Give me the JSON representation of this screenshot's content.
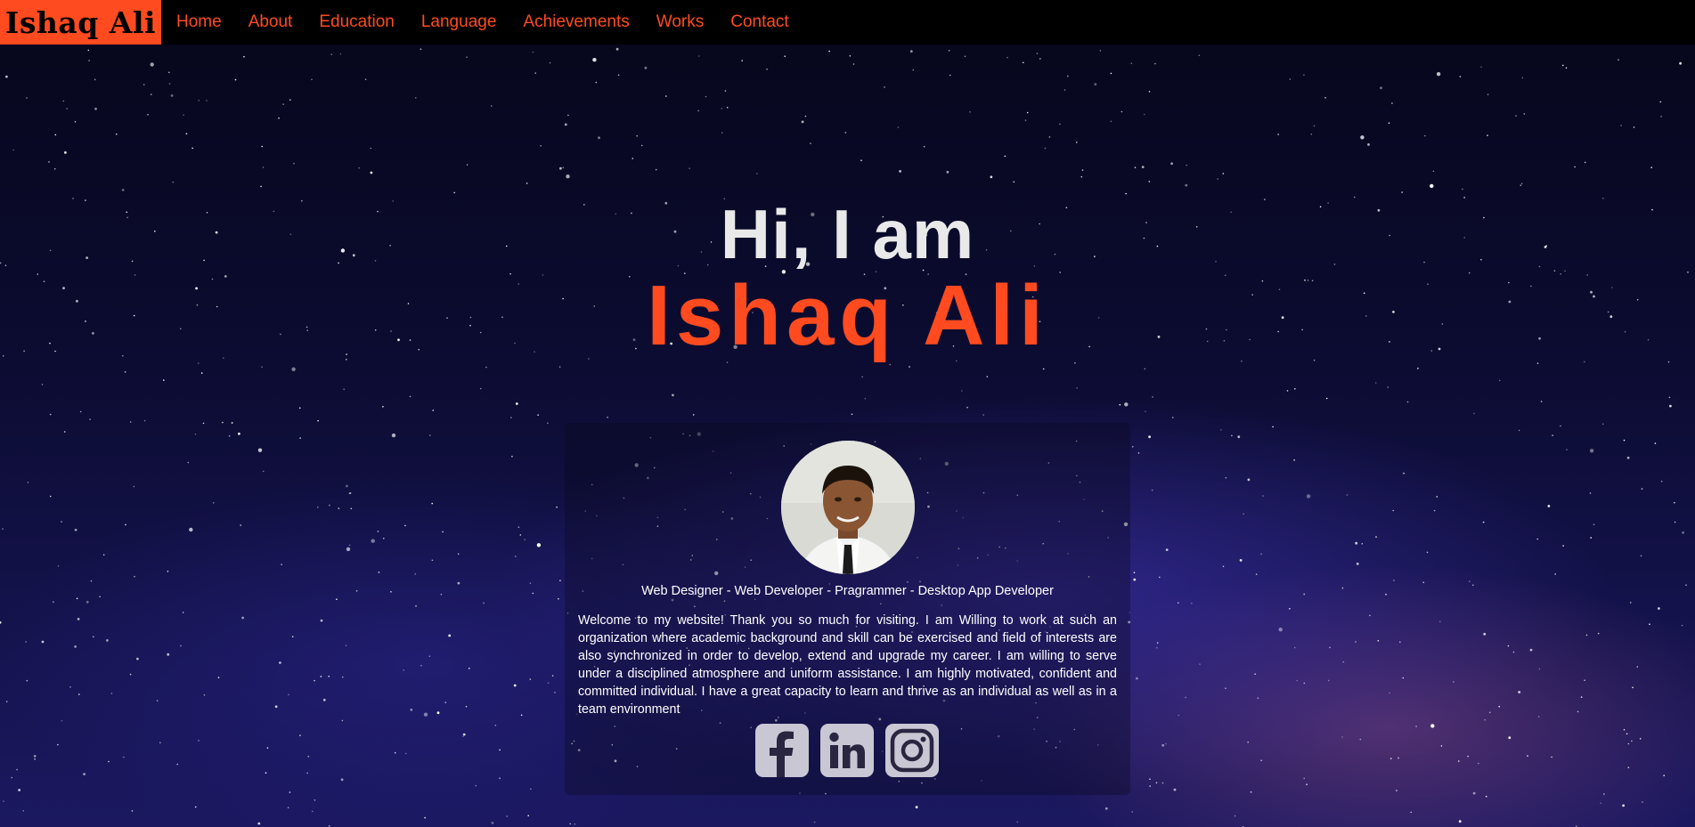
{
  "nav": {
    "brand": "Ishaq Ali",
    "links": [
      "Home",
      "About",
      "Education",
      "Language",
      "Achievements",
      "Works",
      "Contact"
    ]
  },
  "hero": {
    "greeting": "Hi, I am",
    "name": "Ishaq Ali"
  },
  "profile": {
    "roles": "Web Designer - Web Developer - Pragrammer - Desktop App Developer",
    "about": "Welcome to my website! Thank you so much for visiting. I am Willing to work at such an organization where academic background and skill can be exercised and field of interests are also synchronized in order to develop, extend and upgrade my career. I am willing to serve under a disciplined atmosphere and uniform assistance. I am highly motivated, confident and committed individual. I have a great capacity to learn and thrive as an individual as well as in a team environment"
  },
  "social": {
    "icons": [
      "facebook-icon",
      "linkedin-icon",
      "instagram-icon"
    ]
  },
  "colors": {
    "accent": "#ff4b1f",
    "nav_bg": "#000000",
    "text": "#ffffff"
  }
}
